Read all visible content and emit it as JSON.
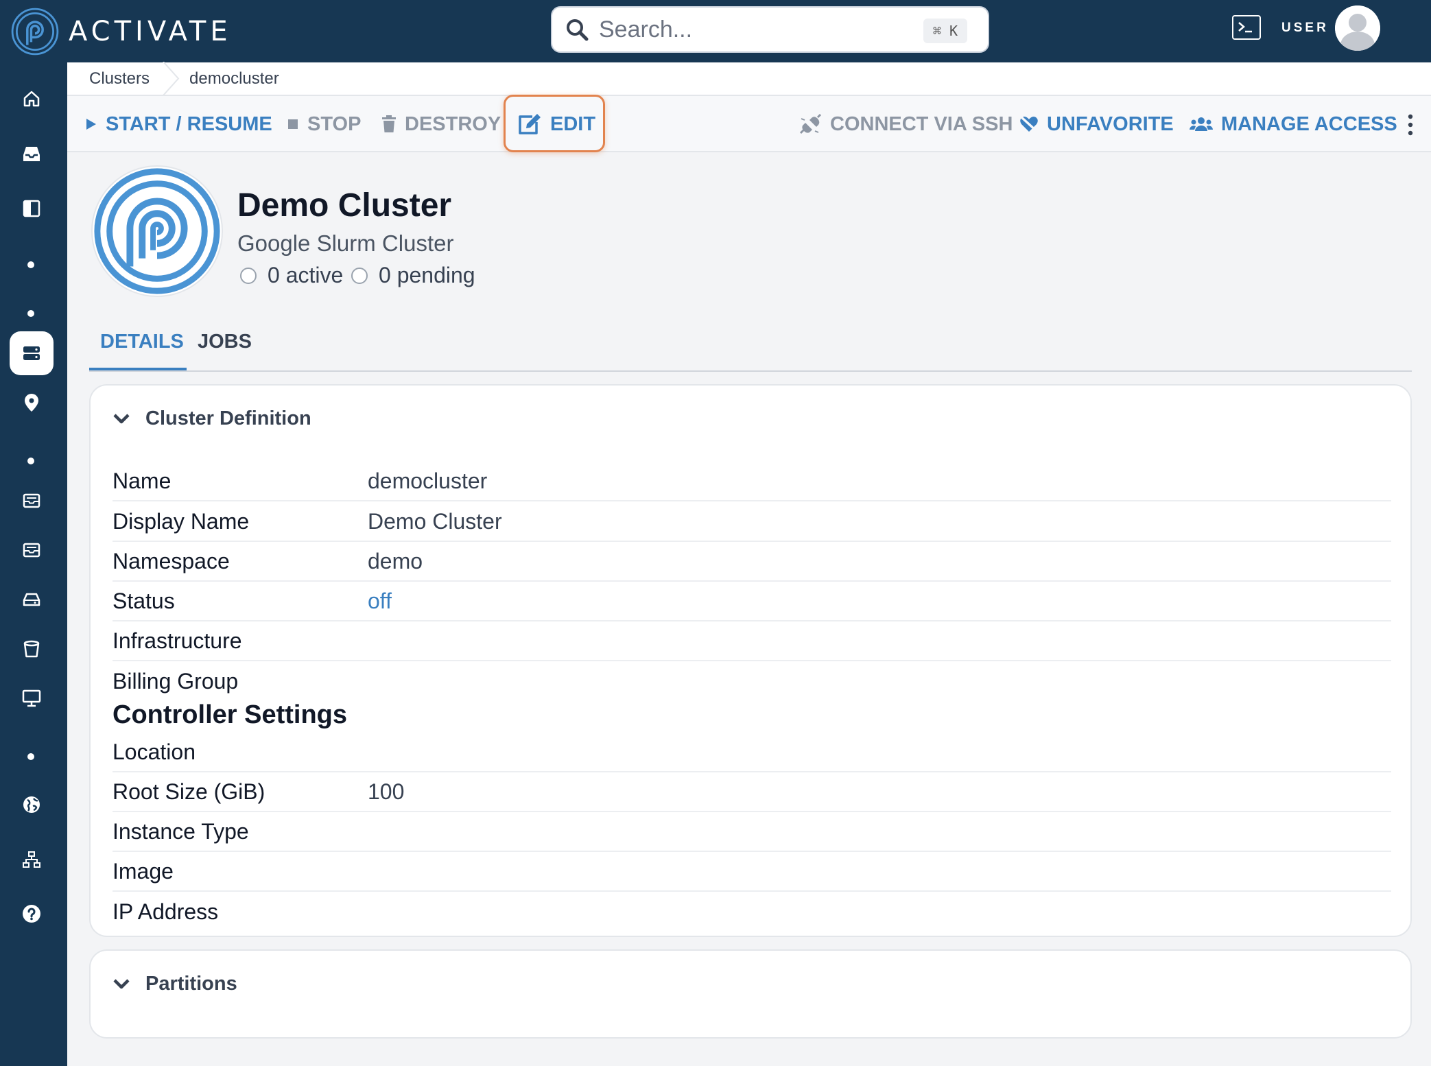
{
  "colors": {
    "topbar": "#173753",
    "accent": "#3a7fc0",
    "muted": "#8d96a3",
    "highlight": "#e2834e"
  },
  "topbar": {
    "brand": "ACTIVATE",
    "search_placeholder": "Search...",
    "search_shortcut": "⌘ K",
    "user_label": "USER"
  },
  "sidebar": {
    "icons": [
      "home-icon",
      "inbox-icon",
      "panel-icon",
      "server-icon",
      "location-pin-icon",
      "storage-icon",
      "storage-icon",
      "drive-icon",
      "bucket-icon",
      "desktop-icon",
      "globe-icon",
      "network-icon",
      "help-icon"
    ],
    "active": "server-icon"
  },
  "breadcrumb": {
    "items": [
      "Clusters",
      "democluster"
    ]
  },
  "actions": {
    "start": "START / RESUME",
    "stop": "STOP",
    "destroy": "DESTROY",
    "edit": "EDIT",
    "ssh": "CONNECT VIA SSH",
    "unfavorite": "UNFAVORITE",
    "manage": "MANAGE ACCESS"
  },
  "cluster": {
    "title": "Demo Cluster",
    "subtitle": "Google Slurm Cluster",
    "active": "0 active",
    "pending": "0 pending"
  },
  "tabs": {
    "details": "DETAILS",
    "jobs": "JOBS"
  },
  "definition": {
    "heading": "Cluster Definition",
    "rows": [
      {
        "key": "Name",
        "value": "democluster"
      },
      {
        "key": "Display Name",
        "value": "Demo Cluster"
      },
      {
        "key": "Namespace",
        "value": "demo"
      },
      {
        "key": "Status",
        "value": "off"
      },
      {
        "key": "Infrastructure",
        "value": ""
      },
      {
        "key": "Billing Group",
        "value": ""
      }
    ],
    "controller_heading": "Controller Settings",
    "controller_rows": [
      {
        "key": "Location",
        "value": ""
      },
      {
        "key": "Root Size (GiB)",
        "value": "100"
      },
      {
        "key": "Instance Type",
        "value": ""
      },
      {
        "key": "Image",
        "value": ""
      },
      {
        "key": "IP Address",
        "value": ""
      }
    ]
  },
  "partitions": {
    "heading": "Partitions"
  }
}
